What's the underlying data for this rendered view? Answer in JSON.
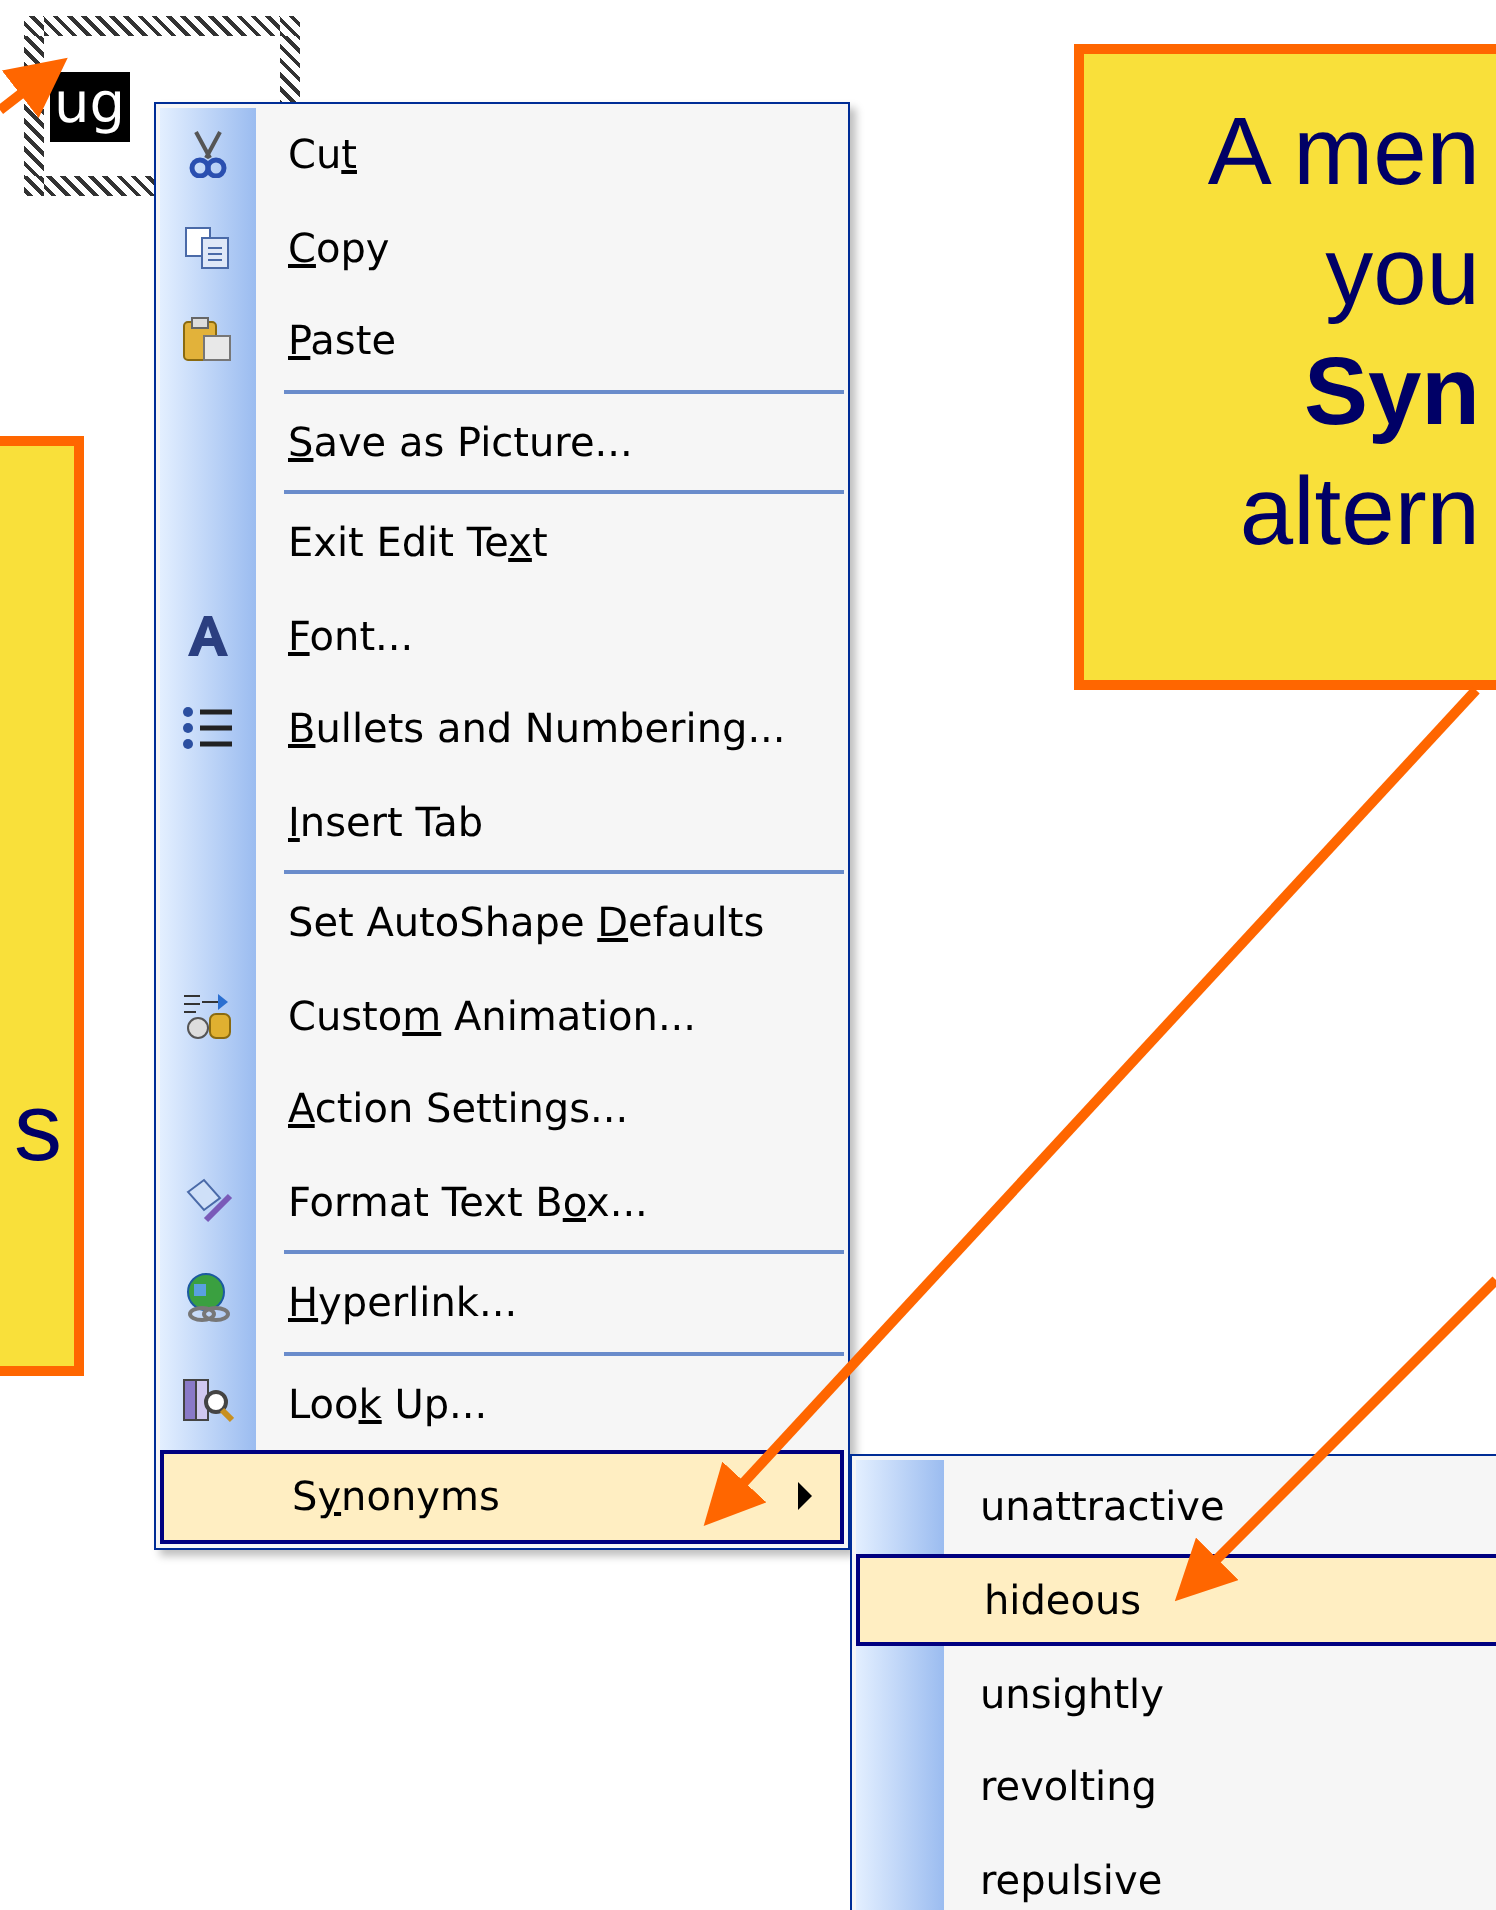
{
  "selection": {
    "text": "ug"
  },
  "callout_left": {
    "lines": [
      "s"
    ]
  },
  "callout_right": {
    "lines": [
      {
        "text": "A men",
        "bold": false
      },
      {
        "text": "you",
        "bold": false
      },
      {
        "text": "Syn",
        "bold": true
      },
      {
        "text": "altern",
        "bold": false
      }
    ]
  },
  "menu": {
    "items": [
      {
        "before": "Cu",
        "key": "t",
        "has_icon": true,
        "separator_before": false,
        "submenu": false,
        "selected": false
      },
      {
        "key": "C",
        "after": "opy",
        "has_icon": true,
        "separator_before": false,
        "submenu": false,
        "selected": false
      },
      {
        "key": "P",
        "after": "aste",
        "has_icon": true,
        "separator_before": false,
        "submenu": false,
        "selected": false
      },
      {
        "key": "S",
        "after": "ave as Picture...",
        "has_icon": false,
        "separator_before": true,
        "submenu": false,
        "selected": false
      },
      {
        "before": "Exit Edit Te",
        "key": "x",
        "after": "t",
        "has_icon": false,
        "separator_before": true,
        "submenu": false,
        "selected": false
      },
      {
        "key": "F",
        "after": "ont...",
        "has_icon": true,
        "separator_before": false,
        "submenu": false,
        "selected": false
      },
      {
        "key": "B",
        "after": "ullets and Numbering...",
        "has_icon": true,
        "separator_before": false,
        "submenu": false,
        "selected": false
      },
      {
        "key": "I",
        "after": "nsert Tab",
        "has_icon": false,
        "separator_before": false,
        "submenu": false,
        "selected": false
      },
      {
        "before": "Set AutoShape ",
        "key": "D",
        "after": "efaults",
        "has_icon": false,
        "separator_before": true,
        "submenu": false,
        "selected": false
      },
      {
        "before": "Custo",
        "key": "m",
        "after": " Animation...",
        "has_icon": true,
        "separator_before": false,
        "submenu": false,
        "selected": false
      },
      {
        "key": "A",
        "after": "ction Settings...",
        "has_icon": false,
        "separator_before": false,
        "submenu": false,
        "selected": false
      },
      {
        "before": "Format Text B",
        "key": "o",
        "after": "x...",
        "has_icon": true,
        "separator_before": false,
        "submenu": false,
        "selected": false
      },
      {
        "key": "H",
        "after": "yperlink...",
        "has_icon": true,
        "separator_before": true,
        "submenu": false,
        "selected": false
      },
      {
        "before": "Loo",
        "key": "k",
        "after": " Up...",
        "has_icon": true,
        "separator_before": true,
        "submenu": false,
        "selected": false
      },
      {
        "before": "S",
        "key": "y",
        "after": "nonyms",
        "has_icon": false,
        "separator_before": false,
        "submenu": true,
        "selected": true
      }
    ]
  },
  "submenu": {
    "items": [
      {
        "label": "unattractive",
        "selected": false
      },
      {
        "label": "hideous",
        "selected": true
      },
      {
        "label": "unsightly",
        "selected": false
      },
      {
        "label": "revolting",
        "selected": false
      },
      {
        "label": "repulsive",
        "selected": false
      }
    ]
  }
}
